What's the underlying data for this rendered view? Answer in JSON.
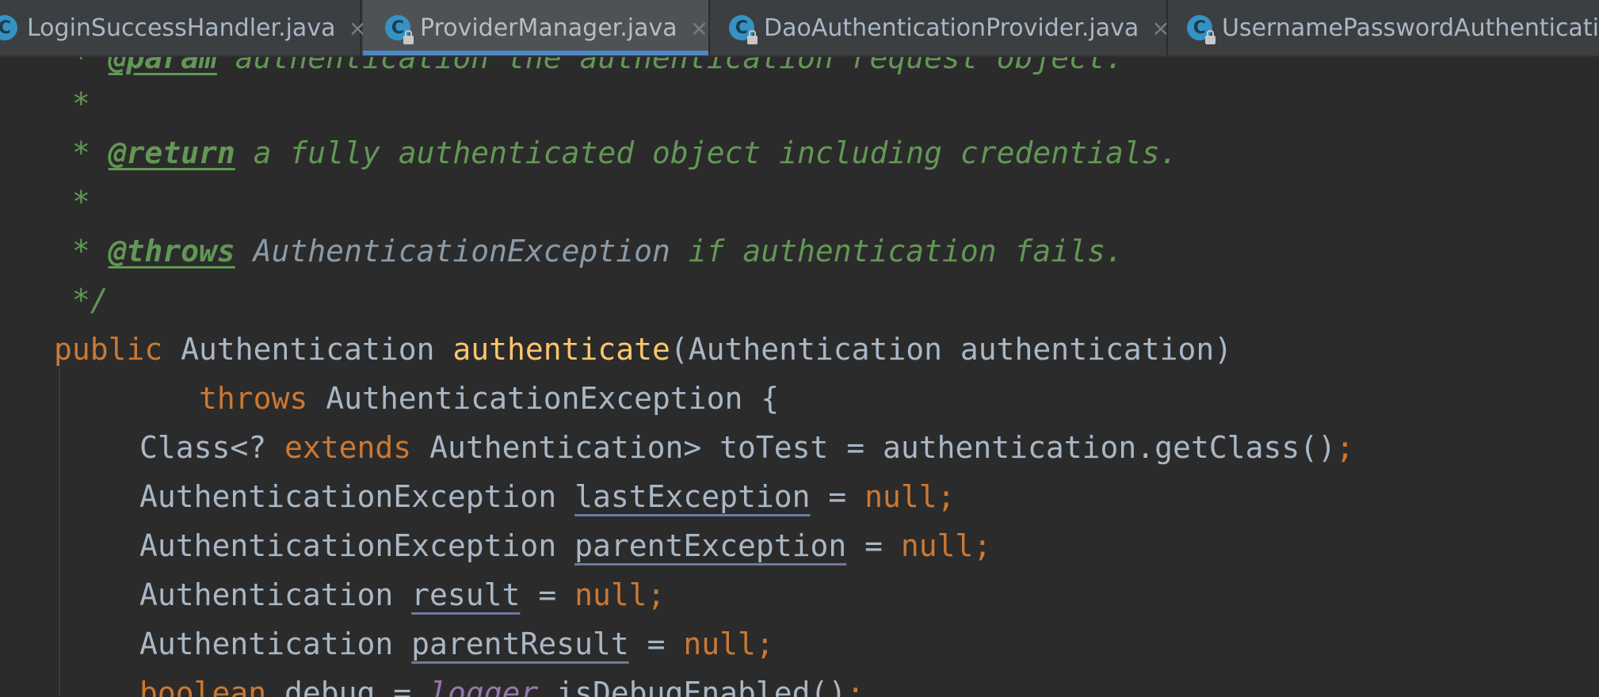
{
  "tabs": [
    {
      "icon": "C",
      "label": "LoginSuccessHandler.java",
      "locked": false,
      "active": false,
      "close": "×"
    },
    {
      "icon": "C",
      "label": "ProviderManager.java",
      "locked": true,
      "active": true,
      "close": "×"
    },
    {
      "icon": "C",
      "label": "DaoAuthenticationProvider.java",
      "locked": true,
      "active": false,
      "close": "×"
    },
    {
      "icon": "C",
      "label": "UsernamePasswordAuthenticatio",
      "locked": true,
      "active": false,
      "close": ""
    }
  ],
  "code": {
    "l0": {
      "star": " * ",
      "tag": "@param",
      "text": " authentication the authentication request object."
    },
    "l1": {
      "star": " *"
    },
    "l2": {
      "star": " * ",
      "tag": "@return",
      "text": " a fully authenticated object including credentials."
    },
    "l3": {
      "star": " *"
    },
    "l4": {
      "star": " * ",
      "tag": "@throws",
      "ref": " AuthenticationException",
      "text": " if authentication fails."
    },
    "l5": {
      "star": " */"
    },
    "l6": {
      "kw": "public",
      "type": " Authentication ",
      "fn": "authenticate",
      "rest": "(Authentication authentication)"
    },
    "l7": {
      "indent": "        ",
      "kw": "throws",
      "rest": " AuthenticationException {"
    },
    "l8": {
      "a": "Class<? ",
      "kw": "extends",
      "b": " Authentication> toTest = authentication.getClass()",
      "semi": ";"
    },
    "l9": {
      "type": "AuthenticationException ",
      "var": "lastException",
      "eq": " = ",
      "kw": "null",
      "semi": ";"
    },
    "l10": {
      "type": "AuthenticationException ",
      "var": "parentException",
      "eq": " = ",
      "kw": "null",
      "semi": ";"
    },
    "l11": {
      "type": "Authentication ",
      "var": "result",
      "eq": " = ",
      "kw": "null",
      "semi": ";"
    },
    "l12": {
      "type": "Authentication ",
      "var": "parentResult",
      "eq": " = ",
      "kw": "null",
      "semi": ";"
    },
    "l13": {
      "kw": "boolean",
      "mid": " debug = ",
      "st": "logger",
      "rest": ".isDebugEnabled()",
      "semi": ";"
    }
  },
  "colors": {
    "background": "#2b2b2b",
    "tab_bar": "#3c3f41",
    "keyword": "#cc7832",
    "method": "#ffc66d",
    "comment": "#629755",
    "text": "#a9b7c6",
    "active_tab_underline": "#4a88c7"
  }
}
